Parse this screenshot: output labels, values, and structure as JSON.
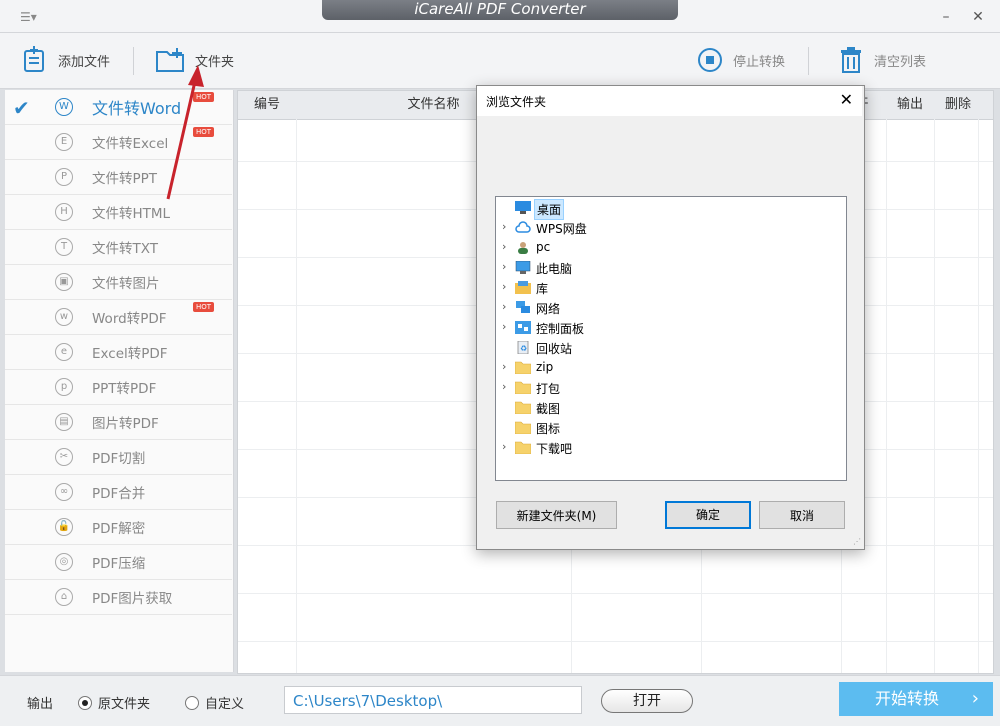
{
  "app": {
    "title": "iCareAll PDF Converter"
  },
  "toolbar": {
    "add_file": "添加文件",
    "folder": "文件夹",
    "stop": "停止转换",
    "clear": "清空列表"
  },
  "sidebar": {
    "items": [
      {
        "label": "文件转Word",
        "icon": "W",
        "hot": true,
        "active": true
      },
      {
        "label": "文件转Excel",
        "icon": "E",
        "hot": true
      },
      {
        "label": "文件转PPT",
        "icon": "P"
      },
      {
        "label": "文件转HTML",
        "icon": "H"
      },
      {
        "label": "文件转TXT",
        "icon": "T"
      },
      {
        "label": "文件转图片",
        "icon": "▣"
      },
      {
        "label": "Word转PDF",
        "icon": "w",
        "hot": true
      },
      {
        "label": "Excel转PDF",
        "icon": "e"
      },
      {
        "label": "PPT转PDF",
        "icon": "p"
      },
      {
        "label": "图片转PDF",
        "icon": "▤"
      },
      {
        "label": "PDF切割",
        "icon": "✂"
      },
      {
        "label": "PDF合并",
        "icon": "∞"
      },
      {
        "label": "PDF解密",
        "icon": "🔓"
      },
      {
        "label": "PDF压缩",
        "icon": "◎"
      },
      {
        "label": "PDF图片获取",
        "icon": "⌂"
      }
    ],
    "hot_badge": "HOT"
  },
  "table": {
    "headers": {
      "index": "编号",
      "filename": "文件名称",
      "open": "开",
      "output": "输出",
      "delete": "删除"
    }
  },
  "bottom": {
    "output_label": "输出",
    "radio_source": "原文件夹",
    "radio_custom": "自定义",
    "path": "C:\\Users\\7\\Desktop\\",
    "open_button": "打开",
    "start_button": "开始转换"
  },
  "dialog": {
    "title": "浏览文件夹",
    "tree": [
      {
        "label": "桌面",
        "icon": "desktop-icon",
        "expandable": false,
        "selected": true
      },
      {
        "label": "WPS网盘",
        "icon": "cloud-icon",
        "expandable": true
      },
      {
        "label": "pc",
        "icon": "user-icon",
        "expandable": true
      },
      {
        "label": "此电脑",
        "icon": "computer-icon",
        "expandable": true
      },
      {
        "label": "库",
        "icon": "library-icon",
        "expandable": true
      },
      {
        "label": "网络",
        "icon": "network-icon",
        "expandable": true
      },
      {
        "label": "控制面板",
        "icon": "control-panel-icon",
        "expandable": true
      },
      {
        "label": "回收站",
        "icon": "recycle-bin-icon",
        "expandable": false
      },
      {
        "label": "zip",
        "icon": "folder-icon",
        "expandable": true
      },
      {
        "label": "打包",
        "icon": "folder-icon",
        "expandable": true
      },
      {
        "label": "截图",
        "icon": "folder-icon",
        "expandable": false
      },
      {
        "label": "图标",
        "icon": "folder-icon",
        "expandable": false
      },
      {
        "label": "下载吧",
        "icon": "folder-icon",
        "expandable": true
      }
    ],
    "new_folder": "新建文件夹(M)",
    "ok": "确定",
    "cancel": "取消"
  },
  "colors": {
    "accent": "#2d86c8",
    "start_button": "#5cbcf0",
    "hot": "#e84c3d"
  }
}
